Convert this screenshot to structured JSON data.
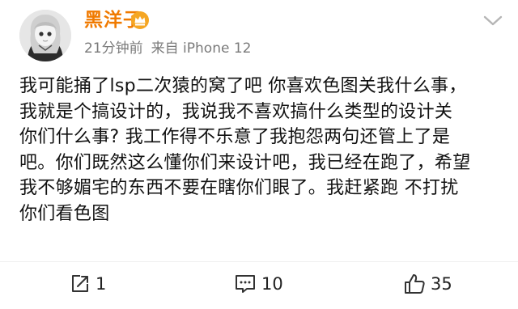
{
  "user": {
    "name": "黑洋子",
    "time": "21分钟前",
    "source": "来自 iPhone 12"
  },
  "icons": {
    "avatar": "avatar",
    "vip": "crown-badge-icon",
    "more": "chevron-down-icon",
    "repost": "repost-icon",
    "comment": "comment-icon",
    "like": "thumbs-up-icon"
  },
  "colors": {
    "username": "#f07a00",
    "meta": "#7a7a7a",
    "badge": "#f5a623"
  },
  "post": {
    "lines": [
      "我可能捅了lsp二次猿的窝了吧  你喜欢色图关我什么事，",
      "我就是个搞设计的，我说我不喜欢搞什么类型的设计关",
      "你们什么事? 我工作得不乐意了我抱怨两句还管上了是",
      "吧。你们既然这么懂你们来设计吧，我已经在跑了，希望",
      "我不够媚宅的东西不要在瞎你们眼了。我赶紧跑 不打扰",
      "你们看色图"
    ]
  },
  "actions": {
    "repost_count": "1",
    "comment_count": "10",
    "like_count": "35"
  }
}
